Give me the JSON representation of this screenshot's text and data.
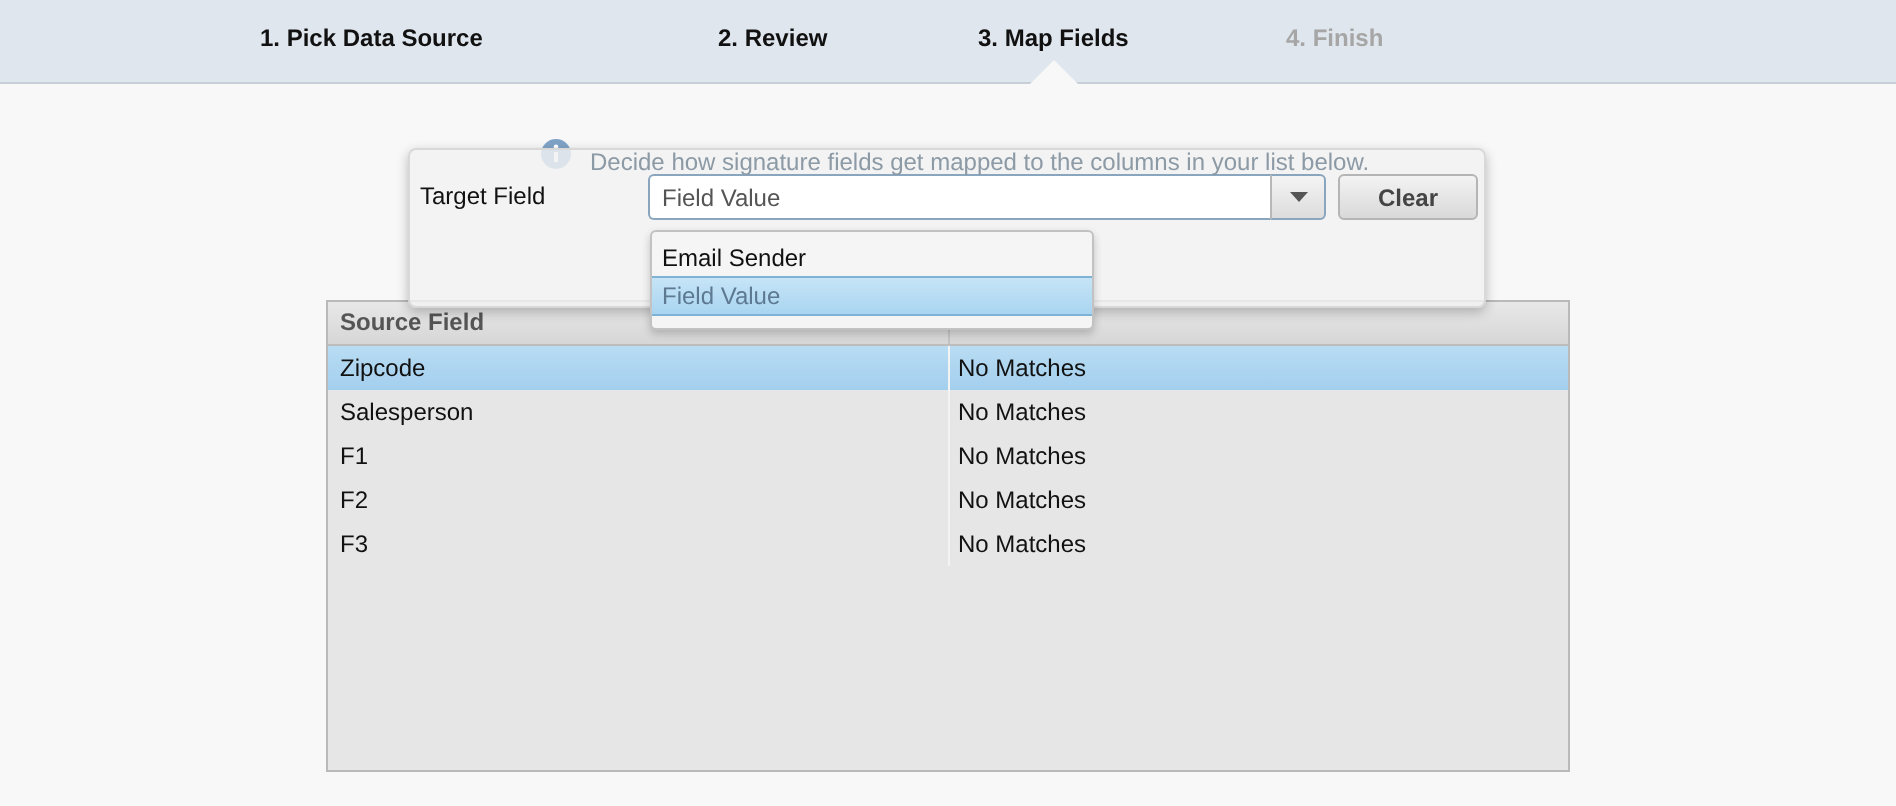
{
  "steps": [
    {
      "label": "1. Pick Data Source",
      "selected": false,
      "disabled": false
    },
    {
      "label": "2. Review",
      "selected": false,
      "disabled": false
    },
    {
      "label": "3. Map Fields",
      "selected": true,
      "disabled": false
    },
    {
      "label": "4. Finish",
      "selected": false,
      "disabled": true
    }
  ],
  "hint": "Decide how signature fields get mapped to the columns in your list below.",
  "popup": {
    "label": "Target Field",
    "value": "Field Value",
    "button": "Clear",
    "options": [
      {
        "label": "Email Sender",
        "selected": false
      },
      {
        "label": "Field Value",
        "selected": true
      }
    ]
  },
  "table": {
    "columns": [
      "Source Field"
    ],
    "rows": [
      {
        "cells": [
          "Zipcode",
          "No Matches"
        ],
        "selected": true
      },
      {
        "cells": [
          "Salesperson",
          "No Matches"
        ],
        "selected": false
      },
      {
        "cells": [
          "F1",
          "No Matches"
        ],
        "selected": false
      },
      {
        "cells": [
          "F2",
          "No Matches"
        ],
        "selected": false
      },
      {
        "cells": [
          "F3",
          "No Matches"
        ],
        "selected": false
      }
    ]
  }
}
